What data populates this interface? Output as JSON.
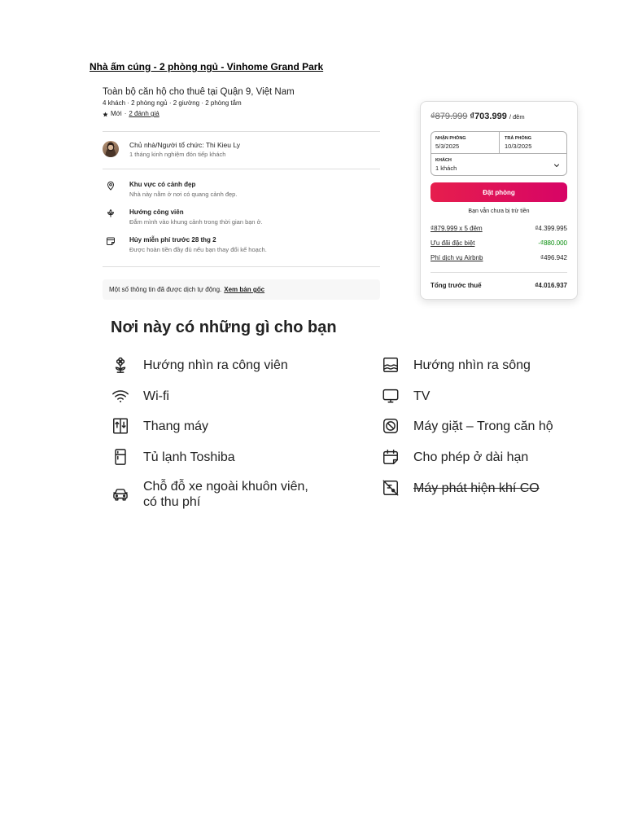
{
  "theme": {
    "accent_start": "#E61E4D",
    "accent_end": "#D70466",
    "discount": "#008A05",
    "text_primary": "#222222",
    "text_secondary": "#6A6A6A"
  },
  "document": {
    "title": "Nhà ấm cúng - 2 phòng ngủ - Vinhome Grand Park"
  },
  "listing": {
    "heading": "Toàn bộ căn hộ cho thuê tại Quận 9, Việt Nam",
    "details": "4 khách · 2 phòng ngủ · 2 giường · 2 phòng tắm",
    "rating": {
      "icon": "star-icon",
      "label": "Mới",
      "separator": "·",
      "reviews_link": "2 đánh giá"
    },
    "host": {
      "title": "Chủ nhà/Người tổ chức: Thi Kieu Ly",
      "experience": "1 tháng kinh nghiệm đón tiếp khách"
    },
    "highlights": [
      {
        "icon": "location-pin-icon",
        "title": "Khu vực có cảnh đẹp",
        "description": "Nhà này nằm ở nơi có quang cảnh đẹp."
      },
      {
        "icon": "leaf-icon",
        "title": "Hướng công viên",
        "description": "Đắm mình vào khung cảnh trong thời gian bạn ở."
      },
      {
        "icon": "calendar-icon",
        "title": "Hủy miễn phí trước 28 thg 2",
        "description": "Được hoàn tiền đầy đủ nếu bạn thay đổi kế hoạch."
      }
    ],
    "translation_notice": {
      "text": "Một số thông tin đã được dịch tự động.",
      "link": "Xem bản gốc"
    }
  },
  "booking": {
    "price": {
      "original": "₫879.999",
      "discounted": "₫703.999",
      "unit": "/ đêm"
    },
    "checkin": {
      "label": "NHẬN PHÒNG",
      "value": "5/3/2025"
    },
    "checkout": {
      "label": "TRẢ PHÒNG",
      "value": "10/3/2025"
    },
    "guests": {
      "label": "KHÁCH",
      "value": "1 khách",
      "icon": "chevron-down-icon"
    },
    "reserve_label": "Đặt phòng",
    "charge_note": "Bạn vẫn chưa bị trừ tiền",
    "breakdown": [
      {
        "label": "₫879.999 x 5 đêm",
        "amount": "₫4.399.995"
      },
      {
        "label": "Ưu đãi đặc biệt",
        "amount": "-₫880.000"
      },
      {
        "label": "Phí dịch vụ Airbnb",
        "amount": "₫496.942"
      }
    ],
    "total": {
      "label": "Tổng trước thuế",
      "amount": "₫4.016.937"
    }
  },
  "amenities": {
    "heading": "Nơi này có những gì cho bạn",
    "left": [
      {
        "icon": "park-view-icon",
        "label": "Hướng nhìn ra công viên",
        "available": true
      },
      {
        "icon": "wifi-icon",
        "label": "Wi-fi",
        "available": true
      },
      {
        "icon": "elevator-icon",
        "label": "Thang máy",
        "available": true
      },
      {
        "icon": "refrigerator-icon",
        "label": "Tủ lạnh Toshiba",
        "available": true
      },
      {
        "icon": "car-icon",
        "label": "Chỗ đỗ xe ngoài khuôn viên, có thu phí",
        "available": true
      }
    ],
    "right": [
      {
        "icon": "river-view-icon",
        "label": "Hướng nhìn ra sông",
        "available": true
      },
      {
        "icon": "tv-icon",
        "label": "TV",
        "available": true
      },
      {
        "icon": "washer-icon",
        "label": "Máy giặt – Trong căn hộ",
        "available": true
      },
      {
        "icon": "calendar-icon",
        "label": "Cho phép ở dài hạn",
        "available": true
      },
      {
        "icon": "co-alarm-off-icon",
        "label": "Máy phát hiện khí CO",
        "available": false
      }
    ]
  }
}
